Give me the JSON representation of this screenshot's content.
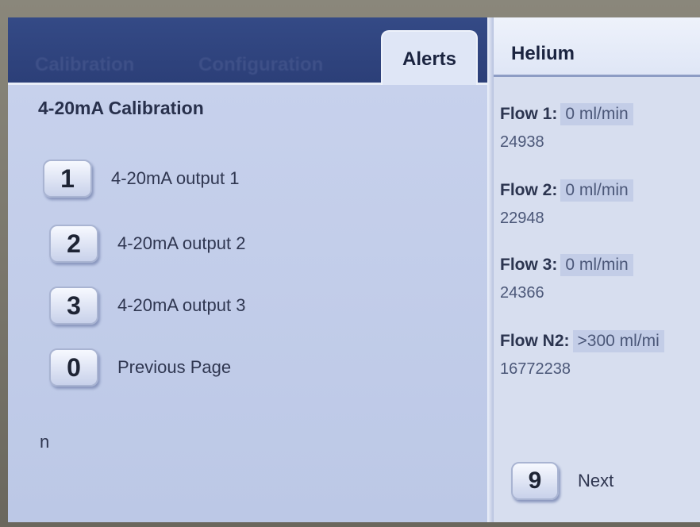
{
  "tabs": [
    {
      "label": "Calibration",
      "active": false
    },
    {
      "label": "Configuration",
      "active": false
    },
    {
      "label": "Alerts",
      "active": true
    }
  ],
  "left": {
    "title": "4-20mA Calibration",
    "items": [
      {
        "key": "1",
        "label": "4-20mA output 1"
      },
      {
        "key": "2",
        "label": "4-20mA output 2"
      },
      {
        "key": "3",
        "label": "4-20mA output 3"
      },
      {
        "key": "0",
        "label": "Previous Page"
      }
    ],
    "stray_text": "n"
  },
  "right": {
    "tab_label": "Helium",
    "flows": [
      {
        "label": "Flow 1:",
        "rate": "0 ml/min",
        "value": "24938"
      },
      {
        "label": "Flow 2:",
        "rate": "0 ml/min",
        "value": "22948"
      },
      {
        "label": "Flow 3:",
        "rate": "0 ml/min",
        "value": "24366"
      },
      {
        "label": "Flow N2:",
        "rate": ">300 ml/mi",
        "value": "16772238"
      }
    ],
    "next": {
      "key": "9",
      "label": "Next"
    }
  }
}
